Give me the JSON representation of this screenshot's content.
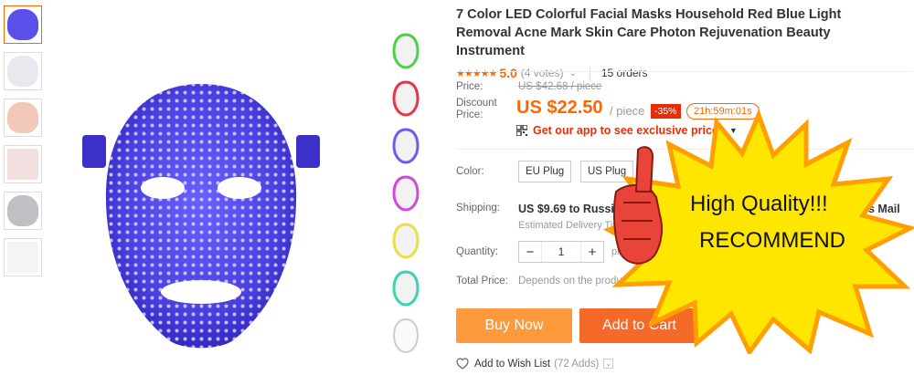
{
  "product": {
    "title": "7 Color LED Colorful Facial Masks Household Red Blue Light Removal Acne Mark Skin Care Photon Rejuvenation Beauty Instrument",
    "rating_value": "5.0",
    "votes": "(4 votes)",
    "orders": "15 orders"
  },
  "price": {
    "price_label": "Price:",
    "old_price": "US $42.68 / piece",
    "discount_label_1": "Discount",
    "discount_label_2": "Price:",
    "new_price": "US $22.50",
    "unit": "/ piece",
    "discount_badge": "-35%",
    "timer": "21h:59m:01s",
    "app_link": "Get our app to see exclusive prices"
  },
  "options": {
    "color_label": "Color:",
    "eu_plug": "EU Plug",
    "us_plug": "US Plug",
    "shipping_label": "Shipping:",
    "shipping_text": "US $9.69 to Russian F",
    "shipping_tail": "s Mail",
    "delivery_text": "Estimated Delivery Tim",
    "quantity_label": "Quantity:",
    "quantity_value": "1",
    "minus": "−",
    "plus": "+",
    "pieces_partial": "pi",
    "total_label": "Total Price:",
    "total_text": "Depends on the product propert"
  },
  "actions": {
    "buy_now": "Buy Now",
    "add_to_cart": "Add to Cart",
    "wish_label": "Add to Wish List",
    "wish_count": "(72 Adds)"
  },
  "promo": {
    "line1": "High Quality!!!",
    "line2": "RECOMMEND"
  },
  "colors": {
    "accent": "#ff6600",
    "buy_now": "#ff9a3c",
    "add_to_cart": "#f56a29",
    "discount_badge": "#e62e04",
    "mask_blue": "#4a3fe0",
    "starburst": "#ffe600"
  },
  "icons": [
    "qr-code-icon",
    "heart-icon",
    "chevron-down-icon",
    "star-icon",
    "thumbs-up-icon"
  ]
}
